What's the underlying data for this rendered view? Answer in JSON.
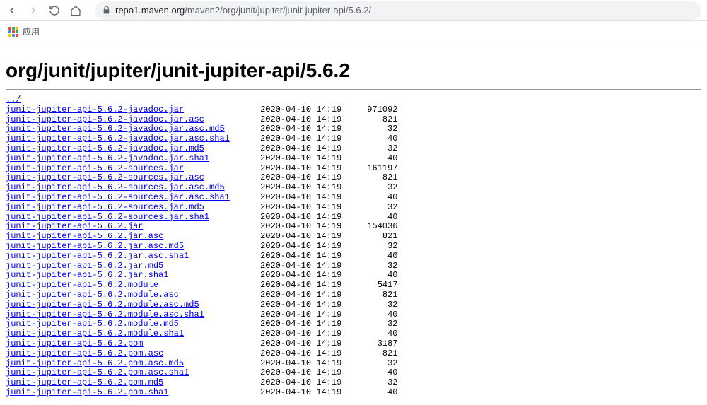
{
  "browser": {
    "url_host": "repo1.maven.org",
    "url_path": "/maven2/org/junit/jupiter/junit-jupiter-api/5.6.2/",
    "bookmarks_apps_label": "应用"
  },
  "page": {
    "heading": "org/junit/jupiter/junit-jupiter-api/5.6.2",
    "parent_link": "../",
    "files": [
      {
        "name": "junit-jupiter-api-5.6.2-javadoc.jar",
        "date": "2020-04-10 14:19",
        "size": "971092"
      },
      {
        "name": "junit-jupiter-api-5.6.2-javadoc.jar.asc",
        "date": "2020-04-10 14:19",
        "size": "821"
      },
      {
        "name": "junit-jupiter-api-5.6.2-javadoc.jar.asc.md5",
        "date": "2020-04-10 14:19",
        "size": "32"
      },
      {
        "name": "junit-jupiter-api-5.6.2-javadoc.jar.asc.sha1",
        "date": "2020-04-10 14:19",
        "size": "40"
      },
      {
        "name": "junit-jupiter-api-5.6.2-javadoc.jar.md5",
        "date": "2020-04-10 14:19",
        "size": "32"
      },
      {
        "name": "junit-jupiter-api-5.6.2-javadoc.jar.sha1",
        "date": "2020-04-10 14:19",
        "size": "40"
      },
      {
        "name": "junit-jupiter-api-5.6.2-sources.jar",
        "date": "2020-04-10 14:19",
        "size": "161197"
      },
      {
        "name": "junit-jupiter-api-5.6.2-sources.jar.asc",
        "date": "2020-04-10 14:19",
        "size": "821"
      },
      {
        "name": "junit-jupiter-api-5.6.2-sources.jar.asc.md5",
        "date": "2020-04-10 14:19",
        "size": "32"
      },
      {
        "name": "junit-jupiter-api-5.6.2-sources.jar.asc.sha1",
        "date": "2020-04-10 14:19",
        "size": "40"
      },
      {
        "name": "junit-jupiter-api-5.6.2-sources.jar.md5",
        "date": "2020-04-10 14:19",
        "size": "32"
      },
      {
        "name": "junit-jupiter-api-5.6.2-sources.jar.sha1",
        "date": "2020-04-10 14:19",
        "size": "40"
      },
      {
        "name": "junit-jupiter-api-5.6.2.jar",
        "date": "2020-04-10 14:19",
        "size": "154036"
      },
      {
        "name": "junit-jupiter-api-5.6.2.jar.asc",
        "date": "2020-04-10 14:19",
        "size": "821"
      },
      {
        "name": "junit-jupiter-api-5.6.2.jar.asc.md5",
        "date": "2020-04-10 14:19",
        "size": "32"
      },
      {
        "name": "junit-jupiter-api-5.6.2.jar.asc.sha1",
        "date": "2020-04-10 14:19",
        "size": "40"
      },
      {
        "name": "junit-jupiter-api-5.6.2.jar.md5",
        "date": "2020-04-10 14:19",
        "size": "32"
      },
      {
        "name": "junit-jupiter-api-5.6.2.jar.sha1",
        "date": "2020-04-10 14:19",
        "size": "40"
      },
      {
        "name": "junit-jupiter-api-5.6.2.module",
        "date": "2020-04-10 14:19",
        "size": "5417"
      },
      {
        "name": "junit-jupiter-api-5.6.2.module.asc",
        "date": "2020-04-10 14:19",
        "size": "821"
      },
      {
        "name": "junit-jupiter-api-5.6.2.module.asc.md5",
        "date": "2020-04-10 14:19",
        "size": "32"
      },
      {
        "name": "junit-jupiter-api-5.6.2.module.asc.sha1",
        "date": "2020-04-10 14:19",
        "size": "40"
      },
      {
        "name": "junit-jupiter-api-5.6.2.module.md5",
        "date": "2020-04-10 14:19",
        "size": "32"
      },
      {
        "name": "junit-jupiter-api-5.6.2.module.sha1",
        "date": "2020-04-10 14:19",
        "size": "40"
      },
      {
        "name": "junit-jupiter-api-5.6.2.pom",
        "date": "2020-04-10 14:19",
        "size": "3187"
      },
      {
        "name": "junit-jupiter-api-5.6.2.pom.asc",
        "date": "2020-04-10 14:19",
        "size": "821"
      },
      {
        "name": "junit-jupiter-api-5.6.2.pom.asc.md5",
        "date": "2020-04-10 14:19",
        "size": "32"
      },
      {
        "name": "junit-jupiter-api-5.6.2.pom.asc.sha1",
        "date": "2020-04-10 14:19",
        "size": "40"
      },
      {
        "name": "junit-jupiter-api-5.6.2.pom.md5",
        "date": "2020-04-10 14:19",
        "size": "32"
      },
      {
        "name": "junit-jupiter-api-5.6.2.pom.sha1",
        "date": "2020-04-10 14:19",
        "size": "40"
      }
    ]
  }
}
